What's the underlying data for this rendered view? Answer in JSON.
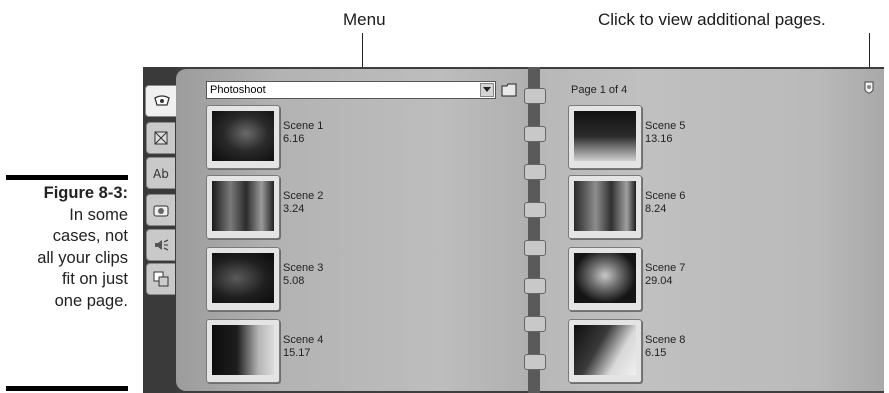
{
  "callouts": {
    "menu": "Menu",
    "pages": "Click to view additional pages."
  },
  "figure": {
    "label": "Figure 8-3:",
    "caption_lines": [
      "In some",
      "cases, not",
      "all your clips",
      "fit on just",
      "one page."
    ]
  },
  "album": {
    "tabs": [
      {
        "name": "video-scenes-tab",
        "icon": "camcorder-icon"
      },
      {
        "name": "transitions-tab",
        "icon": "transition-icon"
      },
      {
        "name": "titles-tab",
        "icon": "title-icon"
      },
      {
        "name": "still-images-tab",
        "icon": "camera-icon"
      },
      {
        "name": "sound-effects-tab",
        "icon": "speaker-icon"
      },
      {
        "name": "menus-tab",
        "icon": "disc-menu-icon"
      }
    ],
    "menu_value": "Photoshoot",
    "page_label": "Page 1 of 4",
    "scenes": [
      {
        "name": "Scene 1",
        "duration": "6.16"
      },
      {
        "name": "Scene 2",
        "duration": "3.24"
      },
      {
        "name": "Scene 3",
        "duration": "5.08"
      },
      {
        "name": "Scene 4",
        "duration": "15.17"
      },
      {
        "name": "Scene 5",
        "duration": "13.16"
      },
      {
        "name": "Scene 6",
        "duration": "8.24"
      },
      {
        "name": "Scene 7",
        "duration": "29.04"
      },
      {
        "name": "Scene 8",
        "duration": "6.15"
      }
    ]
  }
}
